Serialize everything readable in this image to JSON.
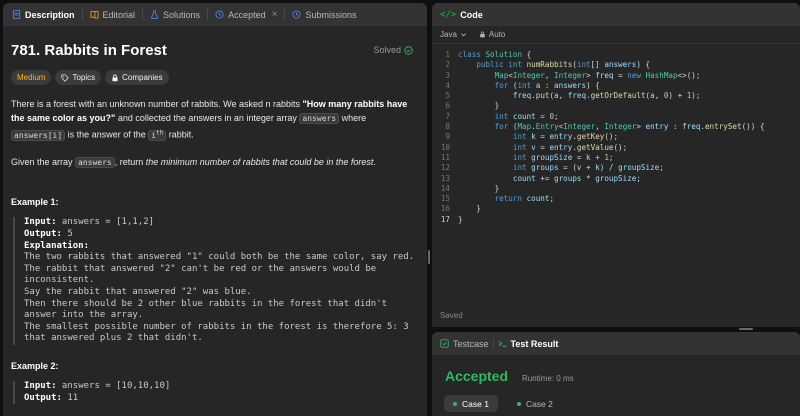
{
  "left_tabs": {
    "description": "Description",
    "editorial": "Editorial",
    "solutions": "Solutions",
    "accepted": "Accepted",
    "submissions": "Submissions",
    "close_glyph": "×"
  },
  "problem": {
    "title": "781. Rabbits in Forest",
    "solved": "Solved",
    "difficulty": "Medium",
    "topics": "Topics",
    "companies": "Companies",
    "para1": {
      "t1": "There is a forest with an unknown number of rabbits. We asked n rabbits ",
      "bold": "\"How many rabbits have the same color as you?\"",
      "t2": " and collected the answers in an integer array ",
      "code1": "answers",
      "t3": " where ",
      "code2": "answers[i]",
      "t4": " is the answer of the ",
      "code3": "i",
      "sup": "th",
      "t5": " rabbit."
    },
    "para2": {
      "t1": "Given the array ",
      "code": "answers",
      "t2": ", return ",
      "em": "the minimum number of rabbits that could be in the forest",
      "t3": "."
    }
  },
  "example1": {
    "heading": "Example 1:",
    "input_label": "Input:",
    "input_value": " answers = [1,1,2]",
    "output_label": "Output:",
    "output_value": " 5",
    "explanation_label": "Explanation:",
    "lines": [
      "The two rabbits that answered \"1\" could both be the same color, say red.",
      "The rabbit that answered \"2\" can't be red or the answers would be",
      "inconsistent.",
      "Say the rabbit that answered \"2\" was blue.",
      "Then there should be 2 other blue rabbits in the forest that didn't",
      "answer into the array.",
      "The smallest possible number of rabbits in the forest is therefore 5: 3",
      "that answered plus 2 that didn't."
    ]
  },
  "example2": {
    "heading": "Example 2:",
    "input_label": "Input:",
    "input_value": " answers = [10,10,10]",
    "output_label": "Output:",
    "output_value": " 11"
  },
  "code_panel": {
    "title": "Code",
    "icon_glyph": "</>",
    "language": "Java",
    "mode": "Auto",
    "status": "Saved",
    "current_line": 17
  },
  "code_lines": [
    [
      [
        "kw",
        "class "
      ],
      [
        "ty",
        "Solution "
      ],
      [
        "p",
        "{"
      ]
    ],
    [
      [
        "p",
        "    "
      ],
      [
        "kw",
        "public int "
      ],
      [
        "fn",
        "numRabbits"
      ],
      [
        "p",
        "("
      ],
      [
        "kw",
        "int"
      ],
      [
        "p",
        "[] "
      ],
      [
        "vr",
        "answers"
      ],
      [
        "p",
        ") {"
      ]
    ],
    [
      [
        "p",
        "        "
      ],
      [
        "ty",
        "Map"
      ],
      [
        "p",
        "<"
      ],
      [
        "ty",
        "Integer"
      ],
      [
        "p",
        ", "
      ],
      [
        "ty",
        "Integer"
      ],
      [
        "p",
        "> "
      ],
      [
        "vr",
        "freq"
      ],
      [
        "p",
        " = "
      ],
      [
        "kw",
        "new "
      ],
      [
        "ty",
        "HashMap"
      ],
      [
        "p",
        "<>();"
      ]
    ],
    [
      [
        "p",
        "        "
      ],
      [
        "kw",
        "for "
      ],
      [
        "p",
        "("
      ],
      [
        "kw",
        "int "
      ],
      [
        "vr",
        "a"
      ],
      [
        "p",
        " : "
      ],
      [
        "vr",
        "answers"
      ],
      [
        "p",
        ") {"
      ]
    ],
    [
      [
        "p",
        "            "
      ],
      [
        "vr",
        "freq"
      ],
      [
        "p",
        "."
      ],
      [
        "fn",
        "put"
      ],
      [
        "p",
        "("
      ],
      [
        "vr",
        "a"
      ],
      [
        "p",
        ", "
      ],
      [
        "vr",
        "freq"
      ],
      [
        "p",
        "."
      ],
      [
        "fn",
        "getOrDefault"
      ],
      [
        "p",
        "("
      ],
      [
        "vr",
        "a"
      ],
      [
        "p",
        ", "
      ],
      [
        "nm",
        "0"
      ],
      [
        "p",
        ") + "
      ],
      [
        "nm",
        "1"
      ],
      [
        "p",
        ");"
      ]
    ],
    [
      [
        "p",
        "        }"
      ]
    ],
    [
      [
        "p",
        "        "
      ],
      [
        "kw",
        "int "
      ],
      [
        "vr",
        "count"
      ],
      [
        "p",
        " = "
      ],
      [
        "nm",
        "0"
      ],
      [
        "p",
        ";"
      ]
    ],
    [
      [
        "p",
        "        "
      ],
      [
        "kw",
        "for "
      ],
      [
        "p",
        "("
      ],
      [
        "ty",
        "Map"
      ],
      [
        "p",
        "."
      ],
      [
        "ty",
        "Entry"
      ],
      [
        "p",
        "<"
      ],
      [
        "ty",
        "Integer"
      ],
      [
        "p",
        ", "
      ],
      [
        "ty",
        "Integer"
      ],
      [
        "p",
        "> "
      ],
      [
        "vr",
        "entry"
      ],
      [
        "p",
        " : "
      ],
      [
        "vr",
        "freq"
      ],
      [
        "p",
        "."
      ],
      [
        "fn",
        "entrySet"
      ],
      [
        "p",
        "()) {"
      ]
    ],
    [
      [
        "p",
        "            "
      ],
      [
        "kw",
        "int "
      ],
      [
        "vr",
        "k"
      ],
      [
        "p",
        " = "
      ],
      [
        "vr",
        "entry"
      ],
      [
        "p",
        "."
      ],
      [
        "fn",
        "getKey"
      ],
      [
        "p",
        "();"
      ]
    ],
    [
      [
        "p",
        "            "
      ],
      [
        "kw",
        "int "
      ],
      [
        "vr",
        "v"
      ],
      [
        "p",
        " = "
      ],
      [
        "vr",
        "entry"
      ],
      [
        "p",
        "."
      ],
      [
        "fn",
        "getValue"
      ],
      [
        "p",
        "();"
      ]
    ],
    [
      [
        "p",
        "            "
      ],
      [
        "kw",
        "int "
      ],
      [
        "vr",
        "groupSize"
      ],
      [
        "p",
        " = "
      ],
      [
        "vr",
        "k"
      ],
      [
        "p",
        " + "
      ],
      [
        "nm",
        "1"
      ],
      [
        "p",
        ";"
      ]
    ],
    [
      [
        "p",
        "            "
      ],
      [
        "kw",
        "int "
      ],
      [
        "vr",
        "groups"
      ],
      [
        "p",
        " = ("
      ],
      [
        "vr",
        "v"
      ],
      [
        "p",
        " + "
      ],
      [
        "vr",
        "k"
      ],
      [
        "p",
        ") / "
      ],
      [
        "vr",
        "groupSize"
      ],
      [
        "p",
        ";"
      ]
    ],
    [
      [
        "p",
        "            "
      ],
      [
        "vr",
        "count"
      ],
      [
        "p",
        " += "
      ],
      [
        "vr",
        "groups"
      ],
      [
        "p",
        " * "
      ],
      [
        "vr",
        "groupSize"
      ],
      [
        "p",
        ";"
      ]
    ],
    [
      [
        "p",
        "        }"
      ]
    ],
    [
      [
        "p",
        "        "
      ],
      [
        "kw",
        "return "
      ],
      [
        "vr",
        "count"
      ],
      [
        "p",
        ";"
      ]
    ],
    [
      [
        "p",
        "    }"
      ]
    ],
    [
      [
        "p",
        "}"
      ]
    ]
  ],
  "result_panel": {
    "testcase_tab": "Testcase",
    "result_tab": "Test Result",
    "verdict": "Accepted",
    "runtime": "Runtime: 0 ms",
    "cases": [
      "Case 1",
      "Case 2"
    ]
  },
  "colors": {
    "accent_green": "#2cbb5d",
    "medium": "#ffb800",
    "panel": "#262626",
    "header": "#333333"
  }
}
